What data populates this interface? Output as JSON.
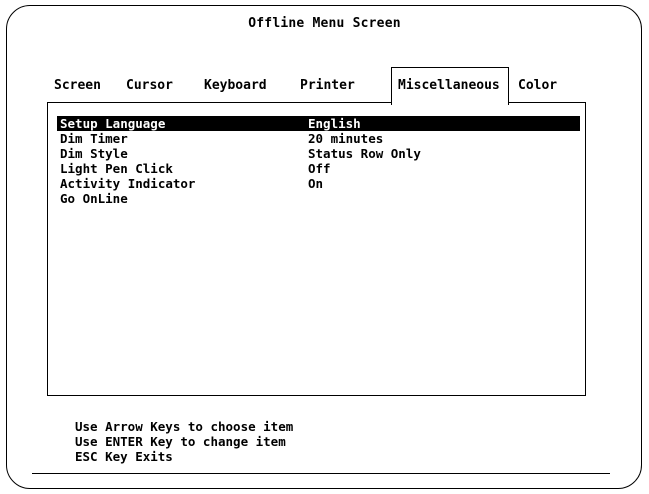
{
  "window": {
    "title": "Offline Menu Screen"
  },
  "tabs": [
    {
      "label": "Screen",
      "active": false
    },
    {
      "label": "Cursor",
      "active": false
    },
    {
      "label": "Keyboard",
      "active": false
    },
    {
      "label": "Printer",
      "active": false
    },
    {
      "label": "Miscellaneous",
      "active": true
    },
    {
      "label": "Color",
      "active": false
    }
  ],
  "menu": {
    "items": [
      {
        "label": "Setup Language",
        "value": "English",
        "selected": true
      },
      {
        "label": "Dim Timer",
        "value": "20 minutes",
        "selected": false
      },
      {
        "label": "Dim Style",
        "value": "Status Row Only",
        "selected": false
      },
      {
        "label": "Light Pen Click",
        "value": "Off",
        "selected": false
      },
      {
        "label": "Activity Indicator",
        "value": "On",
        "selected": false
      },
      {
        "label": "Go OnLine",
        "value": "",
        "selected": false
      }
    ]
  },
  "help": {
    "lines": [
      "Use Arrow Keys to choose item",
      "Use ENTER Key to change item",
      "ESC Key Exits"
    ]
  }
}
